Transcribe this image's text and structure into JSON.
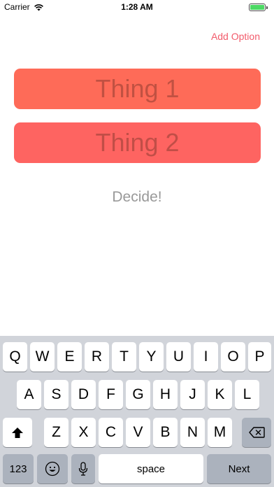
{
  "status_bar": {
    "carrier": "Carrier",
    "time": "1:28 AM",
    "battery_level": 1.0,
    "battery_color": "#4cd964"
  },
  "nav": {
    "add_option_label": "Add Option",
    "accent_color": "#f25b6b"
  },
  "options": [
    {
      "placeholder": "Thing 1"
    },
    {
      "placeholder": "Thing 2"
    }
  ],
  "decide_label": "Decide!",
  "keyboard": {
    "row1": [
      "Q",
      "W",
      "E",
      "R",
      "T",
      "Y",
      "U",
      "I",
      "O",
      "P"
    ],
    "row2": [
      "A",
      "S",
      "D",
      "F",
      "G",
      "H",
      "J",
      "K",
      "L"
    ],
    "row3": [
      "Z",
      "X",
      "C",
      "V",
      "B",
      "N",
      "M"
    ],
    "numbers_label": "123",
    "space_label": "space",
    "next_label": "Next",
    "shift_icon": "shift-icon",
    "delete_icon": "backspace-icon",
    "emoji_icon": "emoji-icon",
    "mic_icon": "microphone-icon"
  }
}
